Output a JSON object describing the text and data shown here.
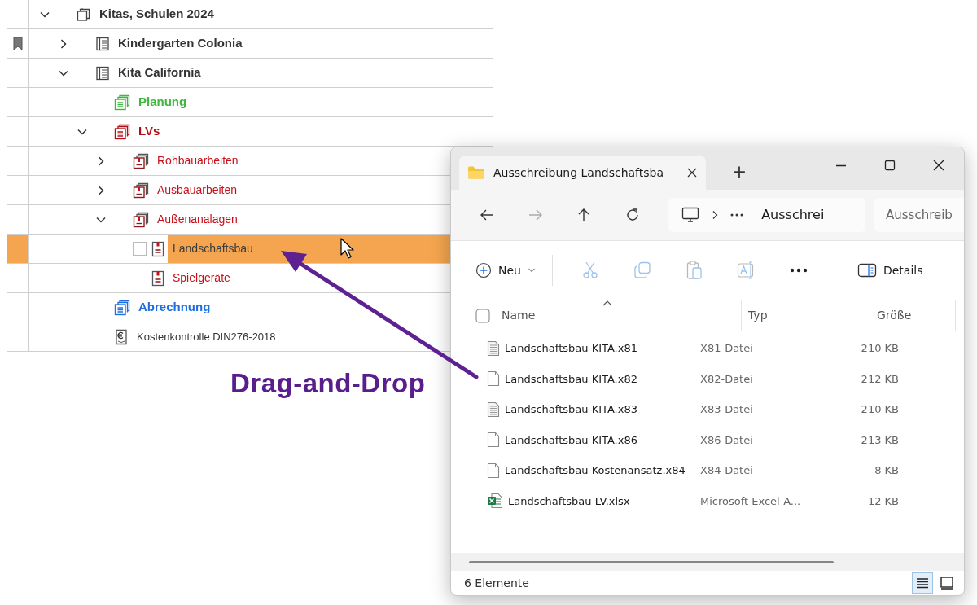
{
  "tree": {
    "items": [
      {
        "label": "Kitas, Schulen 2024",
        "kind": "project",
        "color": "#333333",
        "expanded": true,
        "selected": false,
        "bookmarked": false,
        "children": [
          {
            "label": "Kindergarten Colonia",
            "kind": "site",
            "color": "#333333",
            "expanded": false,
            "selected": false,
            "bookmarked": true
          },
          {
            "label": "Kita California",
            "kind": "site",
            "color": "#333333",
            "expanded": true,
            "selected": false,
            "bookmarked": false,
            "children": [
              {
                "label": "Planung",
                "kind": "phase",
                "color": "#3cb83c",
                "selected": false,
                "bookmarked": false
              },
              {
                "label": "LVs",
                "kind": "phase",
                "color": "#b01015",
                "expanded": true,
                "selected": false,
                "bookmarked": false,
                "children": [
                  {
                    "label": "Rohbauarbeiten",
                    "kind": "lot",
                    "color": "#c8101a",
                    "expanded": false,
                    "selected": false,
                    "bookmarked": false
                  },
                  {
                    "label": "Ausbauarbeiten",
                    "kind": "lot",
                    "color": "#c8101a",
                    "expanded": false,
                    "selected": false,
                    "bookmarked": false
                  },
                  {
                    "label": "Außenanalagen",
                    "kind": "lot",
                    "color": "#c8101a",
                    "expanded": true,
                    "selected": false,
                    "bookmarked": false,
                    "children": [
                      {
                        "label": "Landschaftsbau",
                        "kind": "document",
                        "selected": true,
                        "bookmarked": false,
                        "checked": false
                      },
                      {
                        "label": "Spielgeräte",
                        "kind": "document",
                        "color": "#c8101a",
                        "selected": false,
                        "bookmarked": false
                      }
                    ]
                  }
                ]
              },
              {
                "label": "Abrechnung",
                "kind": "phase",
                "color": "#1f6fe0",
                "selected": false,
                "bookmarked": false
              },
              {
                "label": "Kostenkontrolle DIN276-2018",
                "kind": "costs",
                "color": "#333333",
                "selected": false,
                "bookmarked": false
              }
            ]
          }
        ]
      }
    ]
  },
  "annotation": {
    "label": "Drag-and-Drop"
  },
  "explorer": {
    "tab_title": "Ausschreibung Landschaftsba",
    "new_tab": "+",
    "address": "Ausschrei",
    "search": {
      "placeholder": "Ausschreib"
    },
    "toolbar": {
      "new_label": "Neu",
      "details_label": "Details"
    },
    "columns": [
      "Name",
      "Typ",
      "Größe"
    ],
    "all_selected": false,
    "files": [
      {
        "name": "Landschaftsbau KITA.x81",
        "type": "X81-Datei",
        "size": "210 KB",
        "kind": "text"
      },
      {
        "name": "Landschaftsbau KITA.x82",
        "type": "X82-Datei",
        "size": "212 KB",
        "kind": "blank"
      },
      {
        "name": "Landschaftsbau KITA.x83",
        "type": "X83-Datei",
        "size": "210 KB",
        "kind": "text"
      },
      {
        "name": "Landschaftsbau KITA.x86",
        "type": "X86-Datei",
        "size": "213 KB",
        "kind": "blank"
      },
      {
        "name": "Landschaftsbau Kostenansatz.x84",
        "type": "X84-Datei",
        "size": "8 KB",
        "kind": "blank"
      },
      {
        "name": "Landschaftsbau LV.xlsx",
        "type": "Microsoft Excel-A...",
        "size": "12 KB",
        "kind": "excel"
      }
    ],
    "status": "6 Elemente",
    "views": [
      {
        "kind": "details",
        "selected": true
      },
      {
        "kind": "tiles",
        "selected": false
      }
    ]
  }
}
